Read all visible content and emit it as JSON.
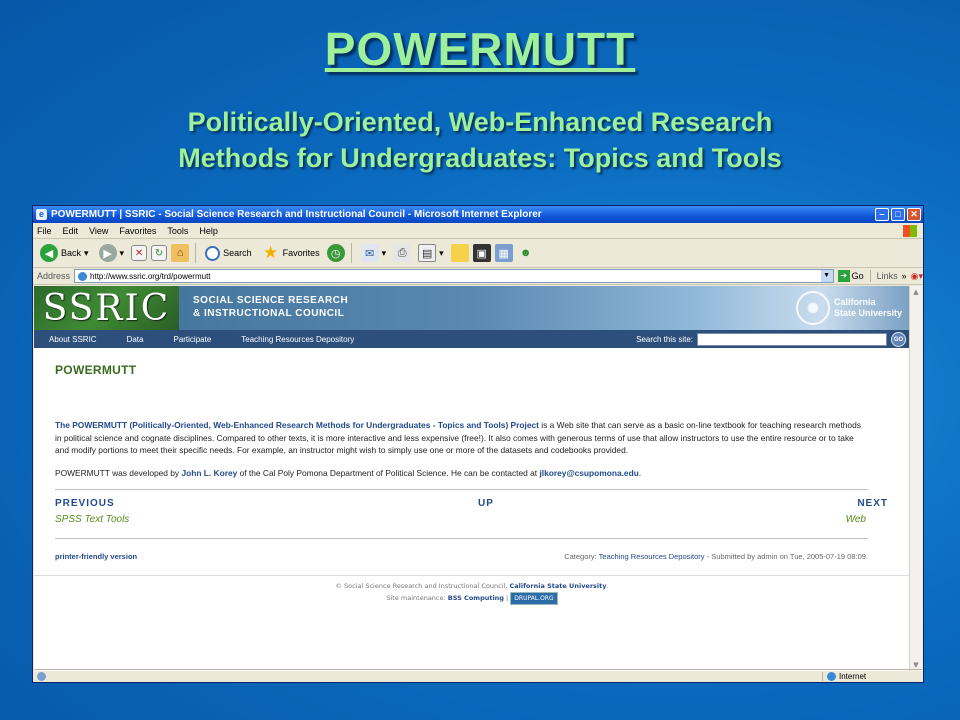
{
  "slide": {
    "title": "POWERMUTT",
    "subtitle_line1": "Politically-Oriented, Web-Enhanced Research",
    "subtitle_line2": "Methods for Undergraduates: Topics and Tools"
  },
  "window": {
    "title": "POWERMUTT | SSRIC - Social Science Research and Instructional Council - Microsoft Internet Explorer",
    "menu": [
      "File",
      "Edit",
      "View",
      "Favorites",
      "Tools",
      "Help"
    ],
    "toolbar": {
      "back_label": "Back",
      "search_label": "Search",
      "favorites_label": "Favorites"
    },
    "address": {
      "label": "Address",
      "url": "http://www.ssric.org/trd/powermutt",
      "go_label": "Go",
      "links_label": "Links"
    },
    "status": {
      "zone": "Internet"
    }
  },
  "site": {
    "logo": "SSRIC",
    "name_line1": "SOCIAL SCIENCE RESEARCH",
    "name_line2": "& INSTRUCTIONAL COUNCIL",
    "csu_line1": "California",
    "csu_line2": "State University",
    "nav": [
      "About SSRIC",
      "Data",
      "Participate",
      "Teaching Resources Depository"
    ],
    "search_label": "Search this site:",
    "search_go": "GO"
  },
  "page": {
    "heading": "POWERMUTT",
    "lead_highlight": "The POWERMUTT (Politically-Oriented, Web-Enhanced Research Methods for Undergraduates - Topics and Tools) Project",
    "lead_rest": " is a Web site that can serve as a basic on-line textbook for teaching research methods in political science and cognate disciplines. Compared to other texts, it is more interactive and less expensive (free!). It also comes with generous terms of use that allow instructors to use the entire resource or to take and modify portions to meet their specific needs. For example, an instructor might wish to simply use one or more of the datasets and codebooks provided.",
    "credit_pre": "POWERMUTT was developed by ",
    "credit_author": "John L. Korey",
    "credit_mid": " of the Cal Poly Pomona Department of Political Science. He can be contacted at ",
    "credit_email": "jlkorey@csupomona.edu",
    "credit_end": ".",
    "book_nav": {
      "previous": "PREVIOUS",
      "up": "UP",
      "next": "NEXT",
      "previous_link": "SPSS Text Tools",
      "next_link": "Web"
    },
    "printer_link": "printer-friendly version",
    "category_pre": "Category: ",
    "category_link": "Teaching Resources Depository",
    "category_post": " - Submitted by admin on Tue, 2005-07-19 08:09.",
    "footer_line1_pre": "© Social Science Research and Instructional Council, ",
    "footer_line1_link": "California State University",
    "footer_line1_end": ".",
    "footer_line2_pre": "Site maintenance: ",
    "footer_line2_link": "BSS Computing",
    "footer_line2_sep": " | ",
    "footer_badge": "DRUPAL.ORG"
  }
}
